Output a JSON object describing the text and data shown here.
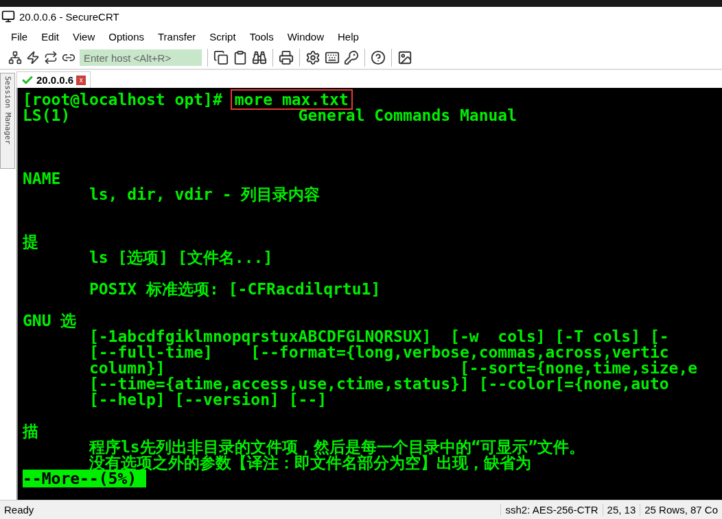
{
  "window": {
    "title": "20.0.0.6 - SecureCRT"
  },
  "menu": [
    "File",
    "Edit",
    "View",
    "Options",
    "Transfer",
    "Script",
    "Tools",
    "Window",
    "Help"
  ],
  "toolbar": {
    "host_field": {
      "placeholder": "Enter host <Alt+R>"
    }
  },
  "session_manager": {
    "label": "Session Manager"
  },
  "tabs": [
    {
      "label": "20.0.0.6",
      "selected": true,
      "connected": true,
      "close": "x"
    }
  ],
  "terminal": {
    "prompt": "[root@localhost opt]# ",
    "command": "more max.txt",
    "blocks": [
      {
        "lines": [
          "LS(1)                        General Commands Manual"
        ]
      },
      {
        "lines": [
          "NAME",
          "       ls, dir, vdir - 列目录内容"
        ]
      },
      {
        "lines": [
          "提",
          "       ls [选项] [文件名...]"
        ]
      },
      {
        "lines": [
          "       POSIX 标准选项: [-CFRacdilqrtu1]"
        ]
      },
      {
        "lines": [
          "GNU 选",
          "       [-1abcdfgiklmnopqrstuxABCDFGLNQRSUX]  [-w  cols] [-T cols] [-",
          "       [--full-time]    [--format={long,verbose,commas,across,vertic",
          "       column}]                               [--sort={none,time,size,e",
          "       [--time={atime,access,use,ctime,status}] [--color[={none,auto",
          "       [--help] [--version] [--]"
        ]
      },
      {
        "lines": [
          "描",
          "       程序ls先列出非目录的文件项，然后是每一个目录中的“可显示”文件。",
          "       没有选项之外的参数【译注：即文件名部分为空】出现，缺省为"
        ]
      }
    ],
    "more_prompt": "--More--(5%)"
  },
  "status_bar": [
    "Ready",
    "ssh2: AES-256-CTR",
    "25, 13",
    "25 Rows, 87 Co"
  ]
}
